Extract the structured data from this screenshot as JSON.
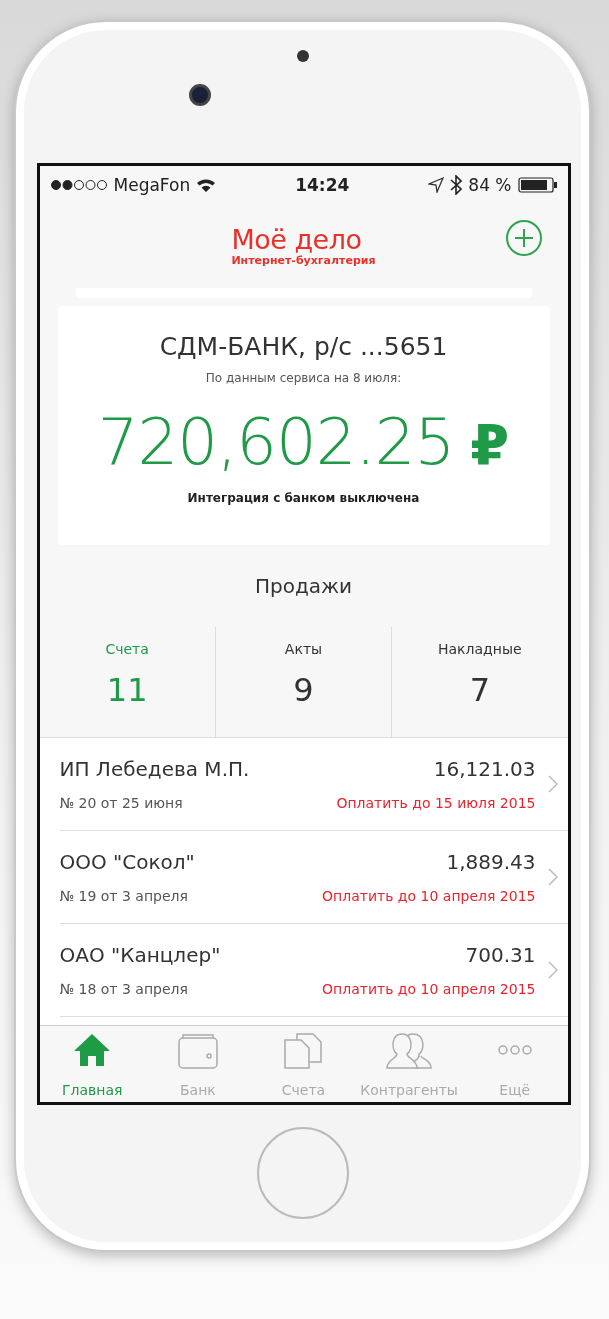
{
  "status_bar": {
    "carrier": "MegaFon",
    "time": "14:24",
    "battery": "84 %"
  },
  "header": {
    "logo_title": "Моё дело",
    "logo_subtitle": "Интернет-бухгалтерия"
  },
  "balance_card": {
    "bank": "СДМ-БАНК, р/с ...5651",
    "as_of": "По данным сервиса на 8 июля:",
    "amount": "720,602.25",
    "currency": "₽",
    "note": "Интеграция с банком выключена"
  },
  "sales": {
    "title": "Продажи",
    "stats": [
      {
        "label": "Счета",
        "count": "11",
        "selected": true
      },
      {
        "label": "Акты",
        "count": "9",
        "selected": false
      },
      {
        "label": "Накладные",
        "count": "7",
        "selected": false
      }
    ]
  },
  "invoices": [
    {
      "client": "ИП Лебедева М.П.",
      "number": "№ 20 от 25 июня",
      "amount": "16,121.03",
      "due": "Оплатить до 15 июля 2015"
    },
    {
      "client": "ООО \"Сокол\"",
      "number": "№ 19 от 3 апреля",
      "amount": "1,889.43",
      "due": "Оплатить до 10 апреля 2015"
    },
    {
      "client": "ОАО \"Канцлер\"",
      "number": "№ 18 от 3 апреля",
      "amount": "700.31",
      "due": "Оплатить до 10 апреля 2015"
    }
  ],
  "tab_bar": [
    {
      "kind": "home",
      "label": "Главная",
      "selected": true
    },
    {
      "kind": "wallet",
      "label": "Банк",
      "selected": false
    },
    {
      "kind": "documents",
      "label": "Счета",
      "selected": false
    },
    {
      "kind": "people",
      "label": "Контрагенты",
      "selected": false
    },
    {
      "kind": "more",
      "label": "Ещё",
      "selected": false
    }
  ]
}
